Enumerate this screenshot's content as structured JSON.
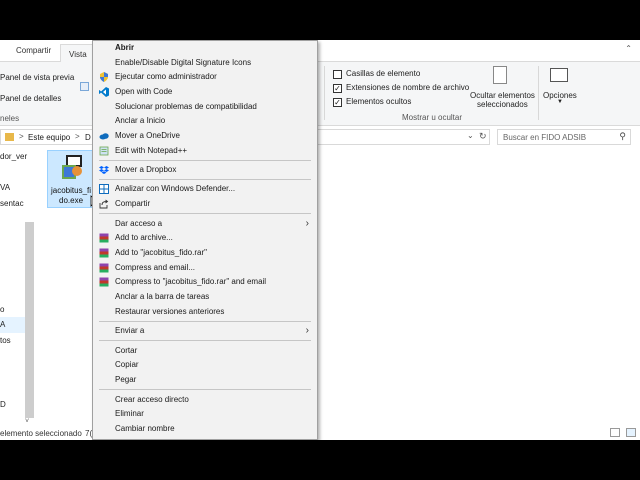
{
  "ribbon": {
    "tabs": [
      {
        "label": "Compartir"
      },
      {
        "label": "Vista"
      }
    ],
    "preview_pane": "Panel de vista previa",
    "details_pane": "Panel de detalles",
    "panels_group": "neles",
    "checkboxes": [
      {
        "label": "Casillas de elemento",
        "checked": false
      },
      {
        "label": "Extensiones de nombre de archivo",
        "checked": true
      },
      {
        "label": "Elementos ocultos",
        "checked": true
      }
    ],
    "hide_selected_line1": "Ocultar elementos",
    "hide_selected_line2": "seleccionados",
    "options": "Opciones",
    "showhide_group": "Mostrar u ocultar"
  },
  "address": {
    "path_start": "Este equipo",
    "path_sep": ">",
    "path_next": "D",
    "search_placeholder": "Buscar en FIDO ADSIB"
  },
  "nav": {
    "items": [
      "dor_ver",
      "VA",
      "sentac",
      "o",
      "A",
      "tos",
      "D"
    ]
  },
  "file": {
    "line1": "jacobitus_fi",
    "line2": "do.exe"
  },
  "status": {
    "text": "elemento seleccionado",
    "size": "7("
  },
  "menu": {
    "items": [
      {
        "label": "Abrir",
        "icon": ""
      },
      {
        "label": "Enable/Disable Digital Signature Icons",
        "icon": ""
      },
      {
        "label": "Ejecutar como administrador",
        "icon": "shield-icon"
      },
      {
        "label": "Open with Code",
        "icon": "vscode-icon"
      },
      {
        "label": "Solucionar problemas de compatibilidad",
        "icon": ""
      },
      {
        "label": "Anclar a Inicio",
        "icon": ""
      },
      {
        "label": "Mover a OneDrive",
        "icon": "onedrive-icon"
      },
      {
        "label": "Edit with Notepad++",
        "icon": "notepad-icon"
      },
      {
        "label": "Mover a Dropbox",
        "icon": "dropbox-icon"
      },
      {
        "label": "Analizar con Windows Defender...",
        "icon": "defender-icon"
      },
      {
        "label": "Compartir",
        "icon": "share-icon"
      },
      {
        "label": "Dar acceso a",
        "icon": "",
        "submenu": true
      },
      {
        "label": "Add to archive...",
        "icon": "winrar-icon"
      },
      {
        "label": "Add to \"jacobitus_fido.rar\"",
        "icon": "winrar-icon"
      },
      {
        "label": "Compress and email...",
        "icon": "winrar-icon"
      },
      {
        "label": "Compress to \"jacobitus_fido.rar\" and email",
        "icon": "winrar-icon"
      },
      {
        "label": "Anclar a la barra de tareas",
        "icon": ""
      },
      {
        "label": "Restaurar versiones anteriores",
        "icon": ""
      },
      {
        "label": "Enviar a",
        "icon": "",
        "submenu": true
      },
      {
        "label": "Cortar",
        "icon": ""
      },
      {
        "label": "Copiar",
        "icon": ""
      },
      {
        "label": "Pegar",
        "icon": ""
      },
      {
        "label": "Crear acceso directo",
        "icon": ""
      },
      {
        "label": "Eliminar",
        "icon": ""
      },
      {
        "label": "Cambiar nombre",
        "icon": ""
      }
    ]
  },
  "colors": {
    "selection": "#cce8ff",
    "menu_bg": "#f2f2f2",
    "winrar": "#c0392b",
    "vscode": "#007acc",
    "onedrive": "#0f6cbd",
    "dropbox": "#0061fe"
  }
}
